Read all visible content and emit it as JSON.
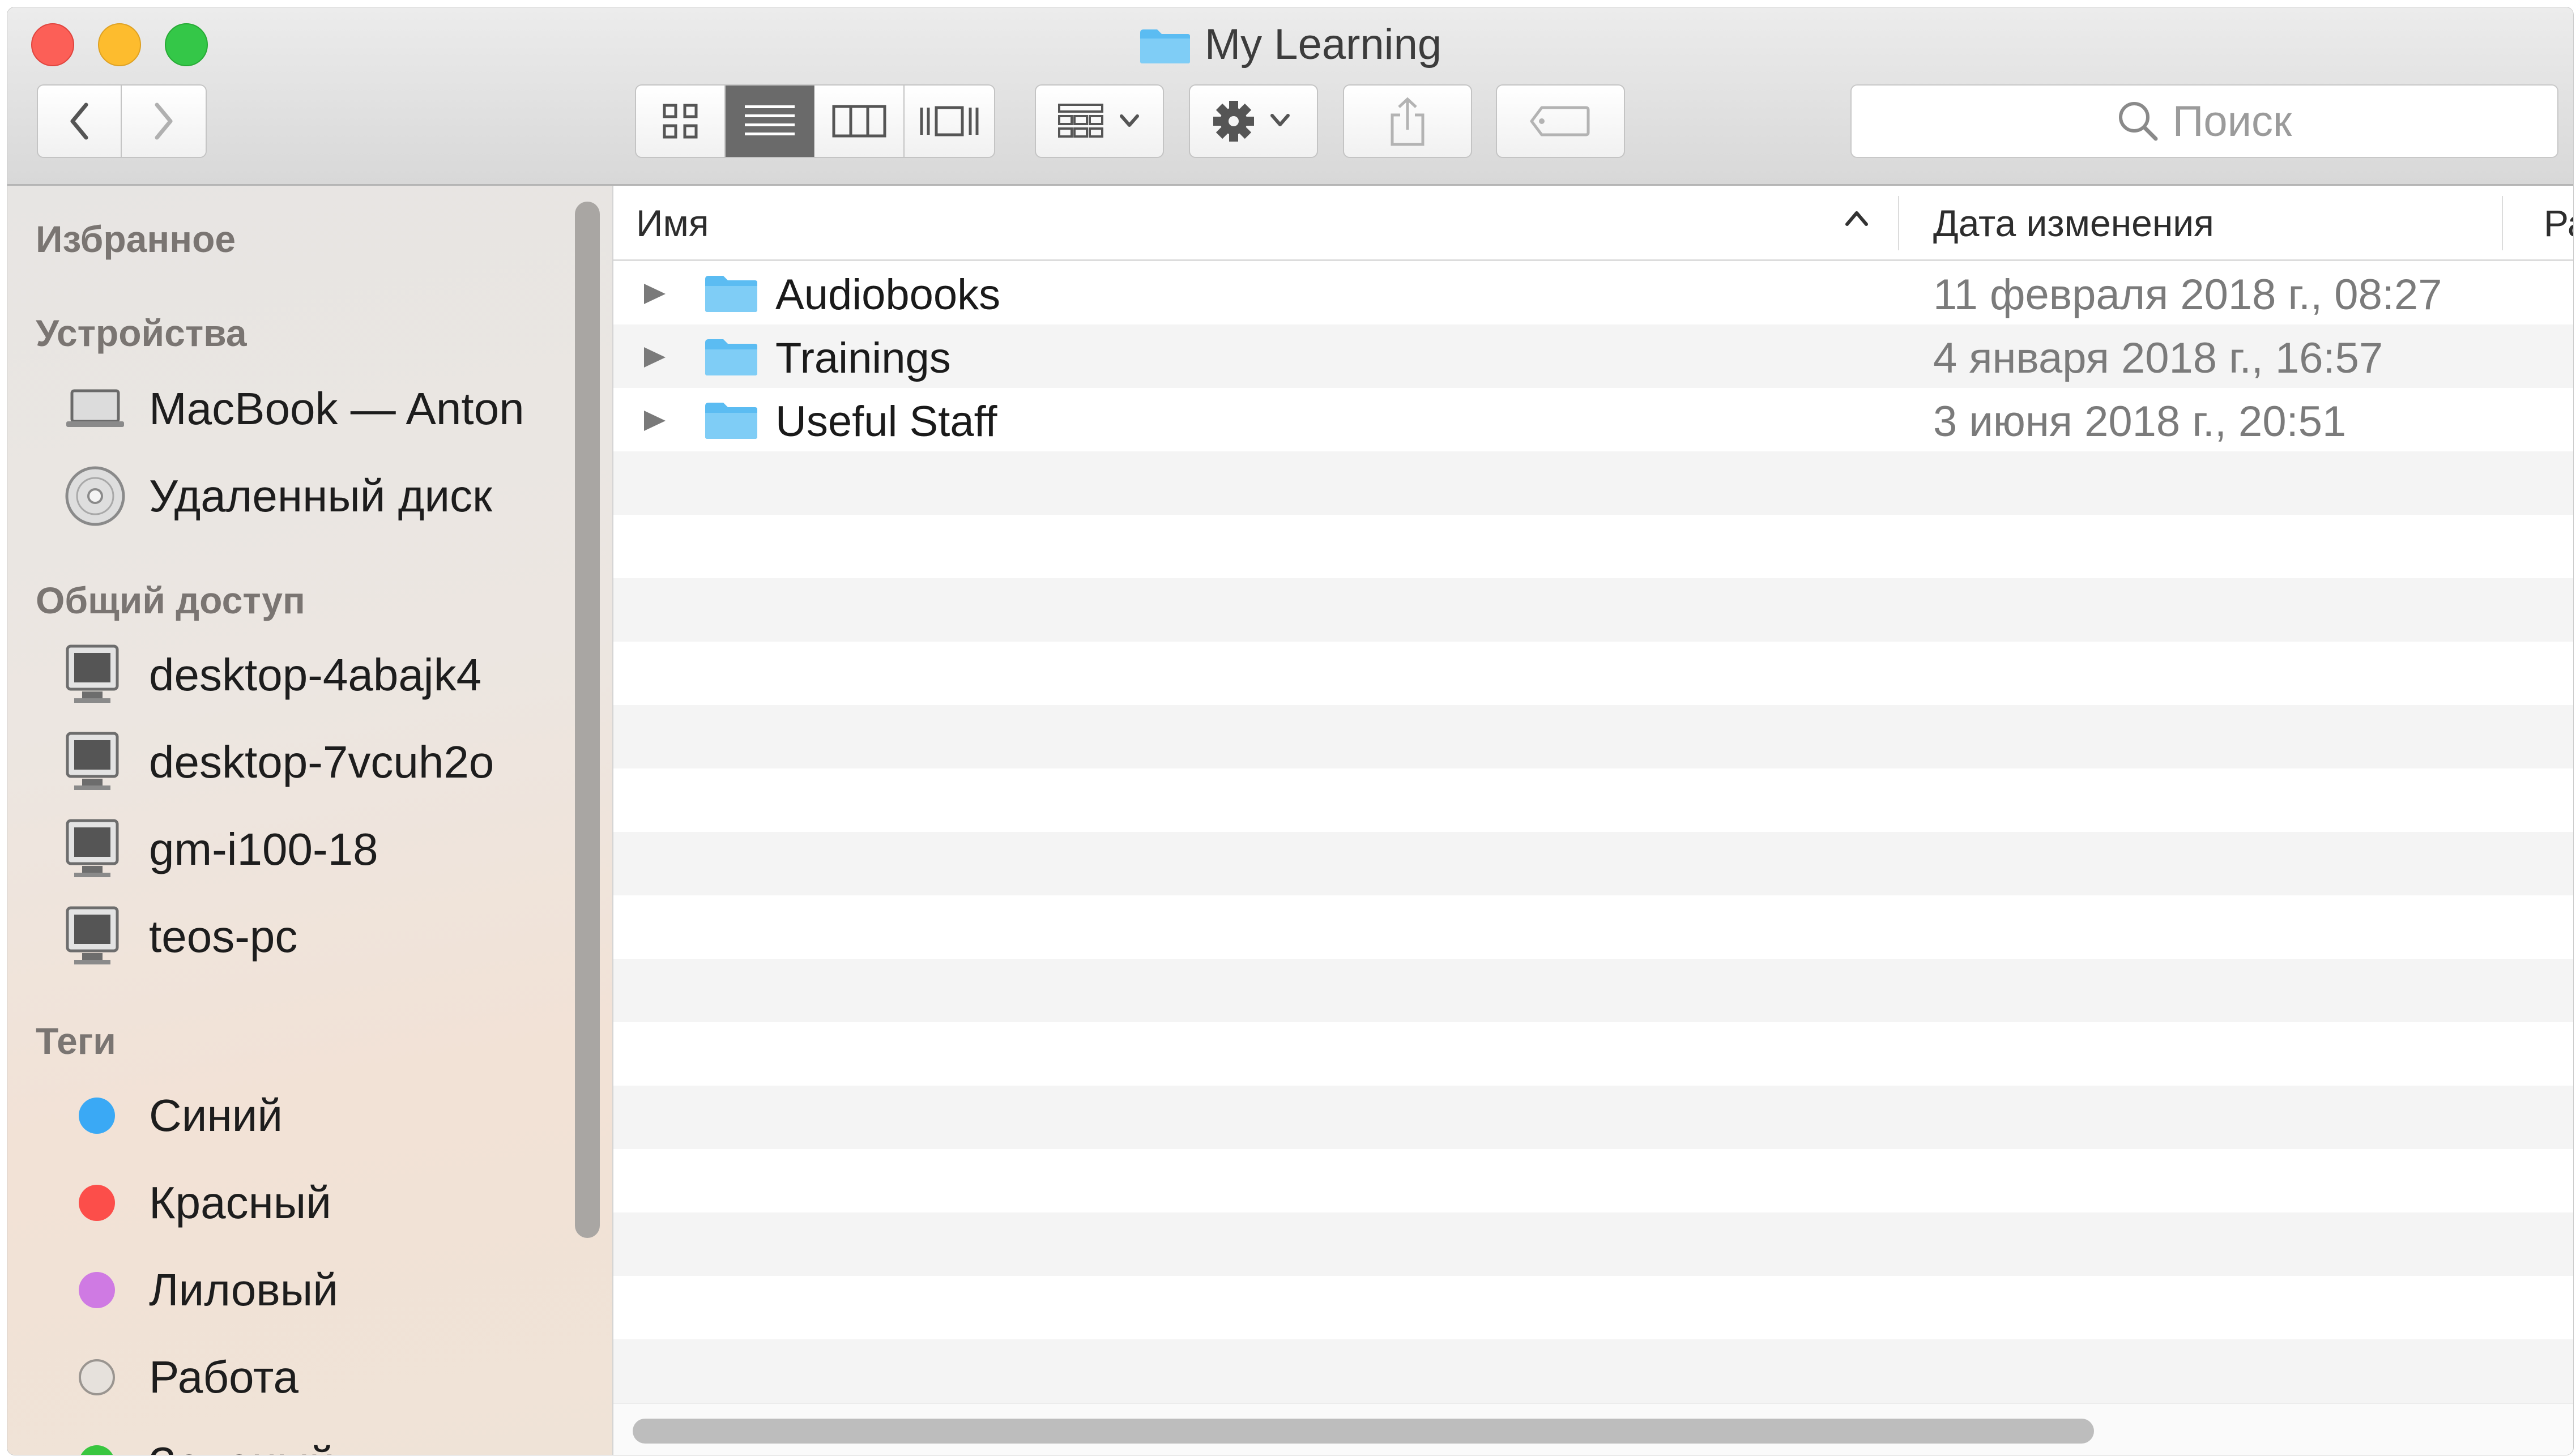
{
  "window": {
    "title": "My Learning"
  },
  "toolbar": {
    "back_icon": "chevron-left-icon",
    "forward_icon": "chevron-right-icon",
    "view_modes": [
      "icon-view",
      "list-view",
      "column-view",
      "cover-flow-view"
    ],
    "active_view": "list-view",
    "search_placeholder": "Поиск"
  },
  "sidebar": {
    "sections": [
      {
        "title": "Избранное",
        "items": []
      },
      {
        "title": "Устройства",
        "items": [
          {
            "label": "MacBook — Anton",
            "icon": "laptop-icon"
          },
          {
            "label": "Удаленный диск",
            "icon": "disc-icon"
          }
        ]
      },
      {
        "title": "Общий доступ",
        "items": [
          {
            "label": "desktop-4abajk4",
            "icon": "monitor-icon"
          },
          {
            "label": "desktop-7vcuh2o",
            "icon": "monitor-icon"
          },
          {
            "label": "gm-i100-18",
            "icon": "monitor-icon"
          },
          {
            "label": "teos-pc",
            "icon": "monitor-icon"
          }
        ]
      },
      {
        "title": "Теги",
        "items": [
          {
            "label": "Синий",
            "color": "#3aa9f5"
          },
          {
            "label": "Красный",
            "color": "#fc4e4a"
          },
          {
            "label": "Лиловый",
            "color": "#cf7ae3"
          },
          {
            "label": "Работа",
            "color": "#d8d4d0"
          },
          {
            "label": "Зеленый",
            "color": "#39c63f"
          }
        ]
      }
    ]
  },
  "columns": {
    "name": "Имя",
    "modified": "Дата изменения",
    "size": "Ра"
  },
  "files": [
    {
      "name": "Audiobooks",
      "modified": "11 февраля 2018 г., 08:27"
    },
    {
      "name": "Trainings",
      "modified": "4 января 2018 г., 16:57"
    },
    {
      "name": "Useful Staff",
      "modified": "3 июня 2018 г., 20:51"
    }
  ],
  "colors": {
    "folder": "#5bbcf2",
    "accent_close": "#fc5f57",
    "accent_min": "#fdbc2e",
    "accent_max": "#34c748"
  }
}
